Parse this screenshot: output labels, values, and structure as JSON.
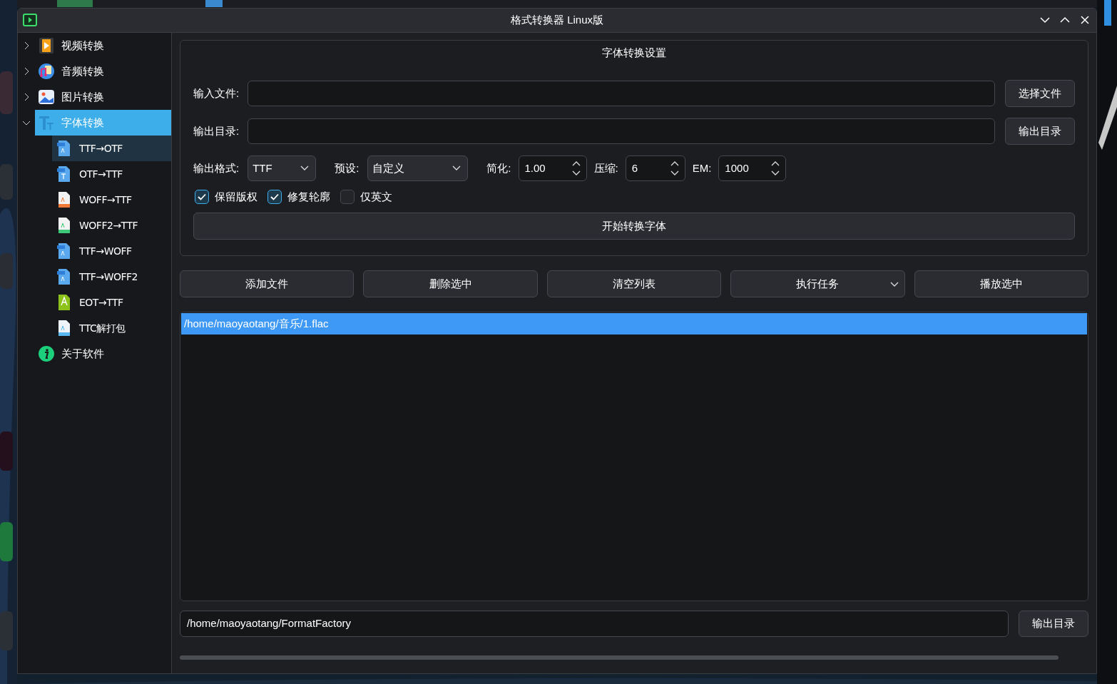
{
  "window": {
    "title": "格式转换器 Linux版"
  },
  "sidebar": {
    "items": [
      {
        "label": "视频转换",
        "kind": "video",
        "expanded": false,
        "selected": false
      },
      {
        "label": "音频转换",
        "kind": "audio",
        "expanded": false,
        "selected": false
      },
      {
        "label": "图片转换",
        "expanded": false,
        "selected": false
      },
      {
        "label": "字体转换",
        "kind": "font",
        "expanded": true,
        "selected": true,
        "children": [
          {
            "label": "TTF→OTF",
            "kind": "ttf",
            "focused": true
          },
          {
            "label": "OTF→TTF",
            "kind": "otf",
            "focused": false
          },
          {
            "label": "WOFF→TTF",
            "kind": "woff",
            "focused": false
          },
          {
            "label": "WOFF2→TTF",
            "kind": "woff2",
            "focused": false
          },
          {
            "label": "TTF→WOFF",
            "kind": "ttf",
            "focused": false
          },
          {
            "label": "TTF→WOFF2",
            "kind": "ttf",
            "focused": false
          },
          {
            "label": "EOT→TTF",
            "kind": "eot",
            "focused": false
          },
          {
            "label": "TTC解打包",
            "kind": "ttc",
            "focused": false
          }
        ]
      },
      {
        "label": "关于软件",
        "kind": "info",
        "selected": false
      }
    ]
  },
  "settings": {
    "title": "字体转换设置",
    "input_file": {
      "label": "输入文件:",
      "button": "选择文件"
    },
    "output_dir": {
      "label": "输出目录:",
      "button": "输出目录"
    },
    "format": {
      "label": "输出格式:",
      "value": "TTF"
    },
    "preset": {
      "label": "预设:",
      "value": "自定义"
    },
    "simplify": {
      "label": "简化:",
      "value": "1.00"
    },
    "compress": {
      "label": "压缩:",
      "value": "6"
    },
    "em": {
      "label": "EM:",
      "value": "1000"
    },
    "checkboxes": [
      {
        "label": "保留版权",
        "checked": true
      },
      {
        "label": "修复轮廓",
        "checked": true
      },
      {
        "label": "仅英文",
        "checked": false
      }
    ],
    "start_button": "开始转换字体"
  },
  "actions": [
    {
      "label": "添加文件"
    },
    {
      "label": "删除选中"
    },
    {
      "label": "清空列表"
    },
    {
      "label": "执行任务",
      "dropdown": true
    },
    {
      "label": "播放选中"
    }
  ],
  "file_list": [
    {
      "path": "/home/maoyaotang/音乐/1.flac",
      "selected": true
    }
  ],
  "output": {
    "path": "/home/maoyaotang/FormatFactory",
    "button": "输出目录"
  }
}
